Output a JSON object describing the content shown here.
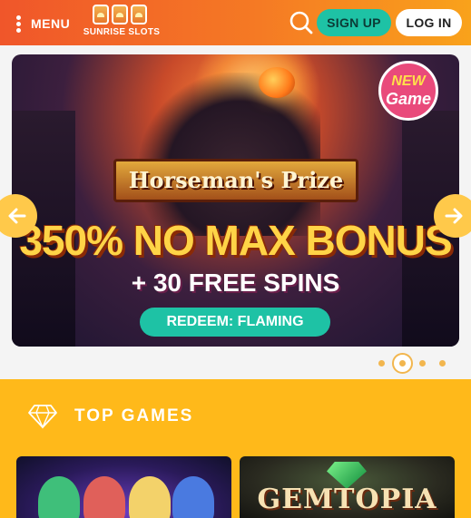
{
  "header": {
    "menu_label": "MENU",
    "logo_text": "SUNRISE SLOTS",
    "signup_label": "SIGN UP",
    "login_label": "LOG IN",
    "colors": {
      "header_start": "#f0562a",
      "header_end": "#f9a21b",
      "signup_bg": "#1ec2a5"
    }
  },
  "banner": {
    "badge_line1": "NEW",
    "badge_line2": "Game",
    "game_title": "Horseman's Prize",
    "bonus_text": "350% NO MAX BONUS",
    "spins_text": "+ 30 FREE SPINS",
    "redeem_text": "REDEEM: FLAMING",
    "pager": {
      "count": 4,
      "active_index": 1
    }
  },
  "top_games": {
    "title": "TOP GAMES",
    "icon": "diamond-icon",
    "tiles": [
      {
        "name": "",
        "visible_title": ""
      },
      {
        "name": "gemtopia",
        "visible_title": "GEMTOPIA"
      }
    ],
    "section_color": "#ffb91a"
  }
}
